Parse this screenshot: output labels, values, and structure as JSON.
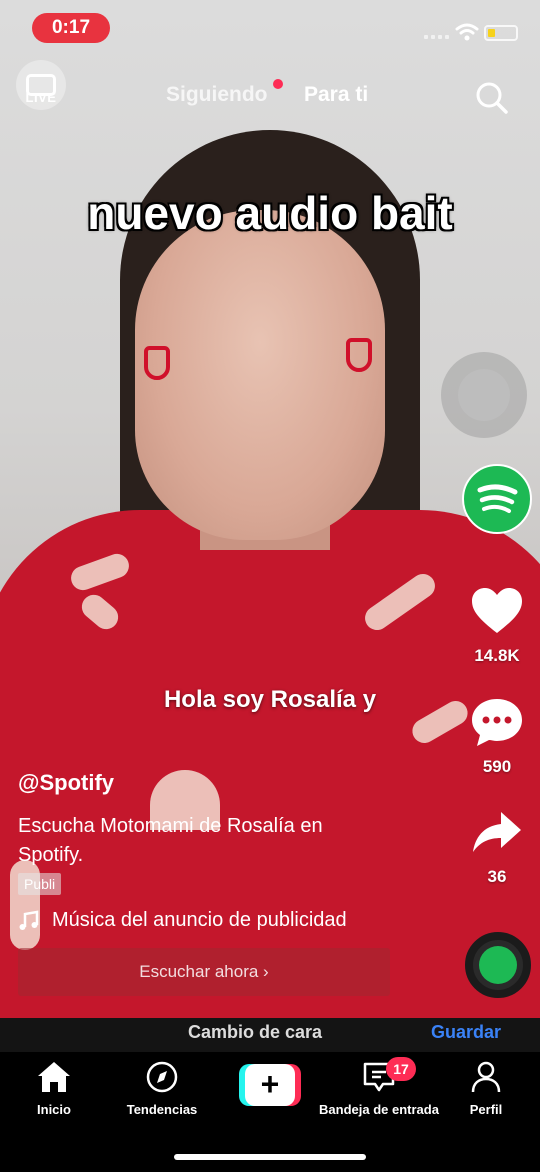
{
  "status_bar": {
    "time": "0:17"
  },
  "top_nav": {
    "live_label": "LIVE",
    "tab_following": "Siguiendo",
    "tab_for_you": "Para ti"
  },
  "video": {
    "caption_top": "nuevo audio bait",
    "caption_sub": "Hola soy Rosalía y"
  },
  "right_rail": {
    "likes": "14.8K",
    "comments": "590",
    "shares": "36"
  },
  "post": {
    "username": "@Spotify",
    "description": "Escucha Motomami de Rosalía en Spotify.",
    "ad_label": "Publi",
    "music_text": "Música del anuncio de publicidad",
    "cta_label": "Escuchar ahora ›"
  },
  "effect_bar": {
    "left_text": "Cambio de cara",
    "right_text": "Guardar"
  },
  "bottom_nav": {
    "home": "Inicio",
    "discover": "Tendencias",
    "create": "+",
    "inbox": "Bandeja de entrada",
    "inbox_badge": "17",
    "profile": "Perfil"
  },
  "colors": {
    "accent_red": "#fe2c55",
    "accent_cyan": "#25f4ee",
    "spotify_green": "#1db954",
    "time_pill": "#e8333f"
  }
}
